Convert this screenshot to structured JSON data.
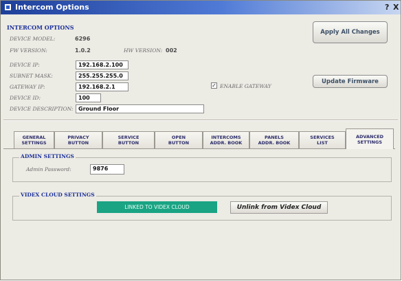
{
  "window": {
    "title": "Intercom Options",
    "help_glyph": "?",
    "close_glyph": "X",
    "title_icon": "app-window-icon"
  },
  "header": {
    "section_title": "INTERCOM OPTIONS",
    "device_model_label": "DEVICE MODEL:",
    "device_model_value": "6296",
    "fw_label": "FW VERSION:",
    "fw_value": "1.0.2",
    "hw_label": "HW VERSION:",
    "hw_value": "002",
    "apply_button": "Apply All Changes",
    "update_button": "Update Firmware"
  },
  "network": {
    "device_ip_label": "DEVICE IP:",
    "device_ip": "192.168.2.100",
    "subnet_label": "SUBNET MASK:",
    "subnet": "255.255.255.0",
    "gateway_label": "GATEWAY IP:",
    "gateway": "192.168.2.1",
    "device_id_label": "DEVICE ID:",
    "device_id": "100",
    "description_label": "DEVICE DESCRIPTION:",
    "description": "Ground Floor",
    "enable_gateway_label": "ENABLE GATEWAY",
    "enable_gateway_checked": true,
    "check_glyph": "✓"
  },
  "tabs": [
    {
      "line1": "GENERAL",
      "line2": "SETTINGS",
      "active": false
    },
    {
      "line1": "PRIVACY",
      "line2": "BUTTON",
      "active": false
    },
    {
      "line1": "SERVICE",
      "line2": "BUTTON",
      "active": false
    },
    {
      "line1": "OPEN",
      "line2": "BUTTON",
      "active": false
    },
    {
      "line1": "INTERCOMS",
      "line2": "ADDR. BOOK",
      "active": false
    },
    {
      "line1": "PANELS",
      "line2": "ADDR. BOOK",
      "active": false
    },
    {
      "line1": "SERVICES",
      "line2": "LIST",
      "active": false
    },
    {
      "line1": "ADVANCED",
      "line2": "SETTINGS",
      "active": true
    }
  ],
  "admin": {
    "group_title": "ADMIN SETTINGS",
    "password_label": "Admin Password:",
    "password_value": "9876"
  },
  "cloud": {
    "group_title": "VIDEX CLOUD SETTINGS",
    "status": "LINKED TO VIDEX CLOUD",
    "status_color": "#1aa484",
    "unlink_button": "Unlink from Videx Cloud"
  }
}
